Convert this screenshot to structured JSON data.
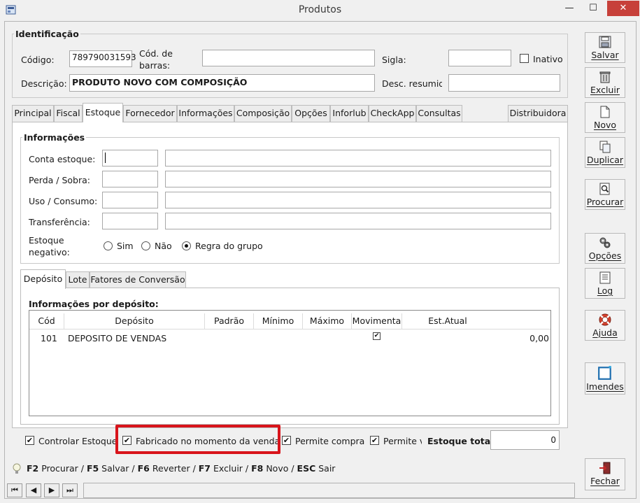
{
  "window": {
    "title": "Produtos",
    "min_label": "—",
    "max_label": "☐",
    "close_label": "✕"
  },
  "identificacao": {
    "title": "Identificação",
    "codigo_label": "Código:",
    "codigo_value": "789790031593",
    "cod_barras_label_1": "Cód. de",
    "cod_barras_label_2": "barras:",
    "cod_barras_value": "",
    "sigla_label": "Sigla:",
    "sigla_value": "",
    "inativo_label": "Inativo",
    "descricao_label": "Descrição:",
    "descricao_value": "PRODUTO NOVO COM COMPOSIÇÃO",
    "desc_resumida_label": "Desc. resumida",
    "desc_resumida_value": ""
  },
  "tabs": [
    {
      "label": "Principal"
    },
    {
      "label": "Fiscal"
    },
    {
      "label": "Estoque"
    },
    {
      "label": "Fornecedor"
    },
    {
      "label": "Informações"
    },
    {
      "label": "Composição"
    },
    {
      "label": "Opções"
    },
    {
      "label": "Inforlub"
    },
    {
      "label": "CheckApp"
    },
    {
      "label": "Consultas"
    },
    {
      "label": "Distribuidora"
    }
  ],
  "informacoes": {
    "title": "Informações",
    "conta_estoque_label": "Conta estoque:",
    "perda_sobra_label": "Perda / Sobra:",
    "uso_consumo_label": "Uso / Consumo:",
    "transferencia_label": "Transferência:",
    "estoque_negativo_label_1": "Estoque",
    "estoque_negativo_label_2": "negativo:",
    "radio_sim": "Sim",
    "radio_nao": "Não",
    "radio_regra": "Regra do grupo"
  },
  "subtabs": [
    {
      "label": "Depósito"
    },
    {
      "label": "Lote"
    },
    {
      "label": "Fatores de Conversão"
    }
  ],
  "deposito": {
    "title": "Informações por depósito:",
    "columns": [
      "Cód",
      "Depósito",
      "Padrão",
      "Mínimo",
      "Máximo",
      "Movimenta",
      "Est.Atual"
    ],
    "rows": [
      {
        "cod": "101",
        "deposito": "DEPOSITO DE VENDAS",
        "padrao": "",
        "minimo": "",
        "maximo": "",
        "movimenta": "✔",
        "est_atual": "0,00"
      }
    ]
  },
  "bottom": {
    "controlar_estoque": "Controlar Estoque",
    "fabricado": "Fabricado no momento da venda",
    "permite_compra": "Permite compra",
    "permite_v": "Permite v",
    "estoque_total_label": "Estoque total:",
    "estoque_total_value": "0",
    "check_mark": "✔"
  },
  "sidebar": {
    "salvar": "Salvar",
    "excluir": "Excluir",
    "novo": "Novo",
    "duplicar": "Duplicar",
    "procurar": "Procurar",
    "opcoes": "Opções",
    "log": "Log",
    "ajuda": "Ajuda",
    "imendes": "Imendes",
    "fechar": "Fechar"
  },
  "shortcuts": {
    "k1": "F2",
    "t1": " Procurar / ",
    "k2": "F5",
    "t2": " Salvar / ",
    "k3": "F6",
    "t3": " Reverter / ",
    "k4": "F7",
    "t4": " Excluir / ",
    "k5": "F8",
    "t5": " Novo / ",
    "k6": "ESC",
    "t6": " Sair"
  },
  "nav": {
    "first": "⏮",
    "prev": "◀",
    "next": "▶",
    "last": "⏭"
  },
  "colors": {
    "highlight": "#d8141b",
    "close_button": "#c7403a"
  }
}
